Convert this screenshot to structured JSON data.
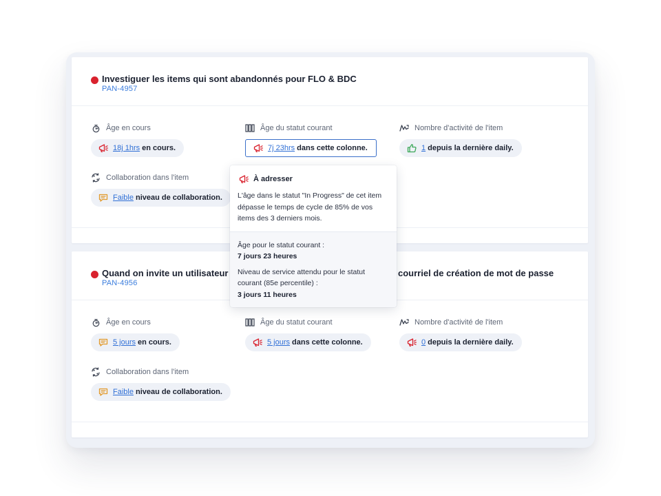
{
  "colors": {
    "accent_link": "#2f6fd6",
    "status_red": "#d9222e",
    "warning_orange": "#e29a2c",
    "ok_green": "#3aa757"
  },
  "labels": {
    "age": "Âge en cours",
    "status_age": "Âge du statut courant",
    "activity": "Nombre d'activité de l'item",
    "collab": "Collaboration dans l'item"
  },
  "cards": [
    {
      "title": "Investiguer les items qui sont abandonnés pour FLO & BDC",
      "key": "PAN-4957",
      "age": {
        "value": "18j 1hrs",
        "suffix": "en cours.",
        "icon": "megaphone-icon"
      },
      "status_age": {
        "value": "7j 23hrs",
        "suffix": "dans cette colonne.",
        "icon": "megaphone-icon"
      },
      "activity": {
        "value": "1",
        "suffix": "depuis la dernière daily.",
        "icon": "thumbs-up-icon"
      },
      "collab": {
        "value": "Faible",
        "suffix": "niveau de collaboration.",
        "icon": "chat-icon"
      }
    },
    {
      "title_start": "Quand on invite un utilisateur e",
      "title_end": "courriel de création de mot de passe",
      "key": "PAN-4956",
      "age": {
        "value": "5 jours",
        "suffix": "en cours.",
        "icon": "chat-icon"
      },
      "status_age": {
        "value": "5 jours",
        "suffix": "dans cette colonne.",
        "icon": "megaphone-icon"
      },
      "activity": {
        "value": "0",
        "suffix": "depuis la dernière daily.",
        "icon": "megaphone-icon"
      },
      "collab": {
        "value": "Faible",
        "suffix": "niveau de collaboration.",
        "icon": "chat-icon"
      }
    }
  ],
  "tooltip": {
    "heading": "À adresser",
    "description": "L'âge dans le statut \"In Progress\" de cet item dépasse le temps de cycle de 85% de vos items des 3 derniers mois.",
    "current_label": "Âge pour le statut courant :",
    "current_value": "7 jours 23 heures",
    "expected_label": "Niveau de service attendu pour le statut courant (85e percentile) :",
    "expected_value": "3 jours 11 heures"
  }
}
